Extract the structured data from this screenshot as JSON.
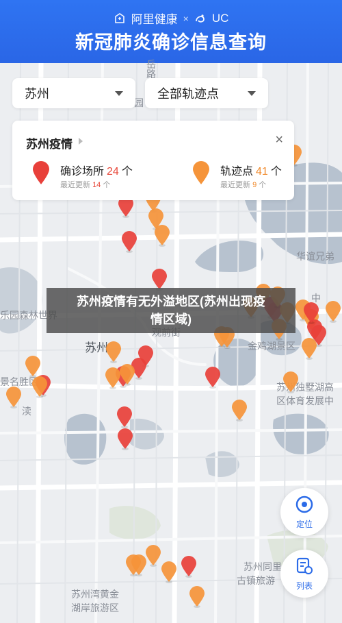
{
  "header": {
    "brand_left": "阿里健康",
    "brand_sep": "×",
    "brand_right": "UC",
    "title": "新冠肺炎确诊信息查询"
  },
  "filters": {
    "city": "苏州",
    "track_type": "全部轨迹点"
  },
  "info_card": {
    "title": "苏州疫情",
    "confirmed": {
      "label": "确诊场所",
      "count": "24",
      "unit": "个",
      "recent_prefix": "最近更新",
      "recent_count": "14",
      "recent_unit": "个"
    },
    "tracks": {
      "label": "轨迹点",
      "count": "41",
      "unit": "个",
      "recent_prefix": "最近更新",
      "recent_count": "9",
      "recent_unit": "个"
    },
    "close": "×"
  },
  "banner": {
    "line1": "苏州疫情有无外溢地区(苏州出现疫",
    "line2": "情区域)"
  },
  "map_labels": {
    "road_top": "路",
    "road_top2": "岳",
    "yuan": "园",
    "huayi": "华谊兄弟",
    "forest": "乐园森林世界",
    "guanqian": "观前街",
    "suzhou": "苏州",
    "jinji": "金鸡湖景区",
    "zhong": "中",
    "dushu1": "苏州独墅湖高",
    "dushu2": "区体育发展中",
    "jingming": "景名胜区",
    "lu": "渎",
    "tongli1": "苏州同里",
    "tongli2": "古镇旅游",
    "wanhuang1": "苏州湾黄金",
    "wanhuang2": "湖岸旅游区"
  },
  "fabs": {
    "locate": "定位",
    "list": "列表"
  },
  "colors": {
    "header": "#2f74f2",
    "confirmed_marker": "#e8403a",
    "track_marker": "#f5943a",
    "accent_red": "#e84a3c",
    "accent_orange": "#f08a2c",
    "fab_blue": "#2b6be8"
  },
  "markers": {
    "confirmed": 24,
    "tracks": 41
  }
}
